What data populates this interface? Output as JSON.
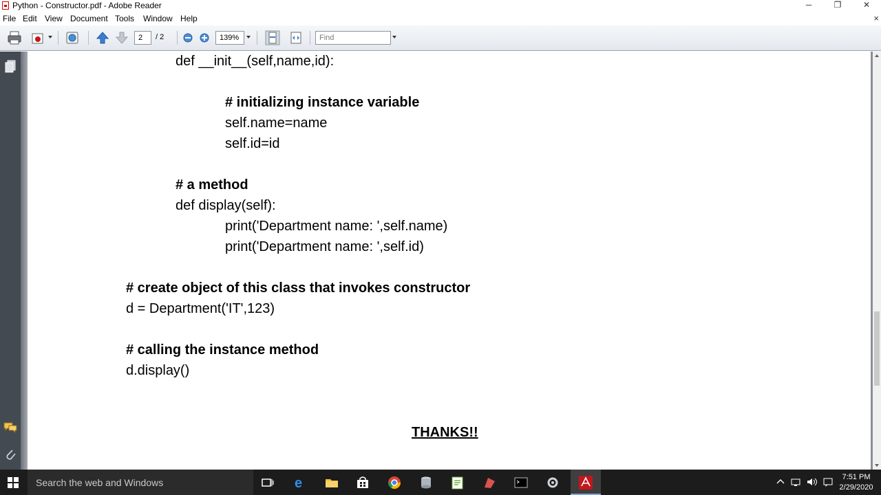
{
  "window": {
    "title": "Python - Constructor.pdf - Adobe Reader",
    "minimize": "─",
    "restore": "❐",
    "close": "✕"
  },
  "menu": [
    "File",
    "Edit",
    "View",
    "Document",
    "Tools",
    "Window",
    "Help"
  ],
  "menu_close": "×",
  "toolbar": {
    "page_current": "2",
    "page_total": "/ 2",
    "zoom": "139%",
    "find_placeholder": "Find"
  },
  "document": {
    "lines": [
      "def __init__(self,name,id):",
      "# initializing instance variable",
      "self.name=name",
      "self.id=id",
      "# a method",
      "def display(self):",
      "print('Department name: ',self.name)",
      "print('Department name: ',self.id)",
      "# create object of this class that invokes constructor",
      "d = Department('IT',123)",
      "# calling the instance method",
      "d.display()"
    ],
    "thanks": "THANKS!!"
  },
  "taskbar": {
    "search_placeholder": "Search the web and Windows",
    "time": "7:51 PM",
    "date": "2/29/2020"
  },
  "colors": {
    "toolbar_bg": "#e4e8ee",
    "left_panel": "#444a52",
    "taskbar": "#1c1c1c",
    "acrobat_red": "#c4161c"
  }
}
